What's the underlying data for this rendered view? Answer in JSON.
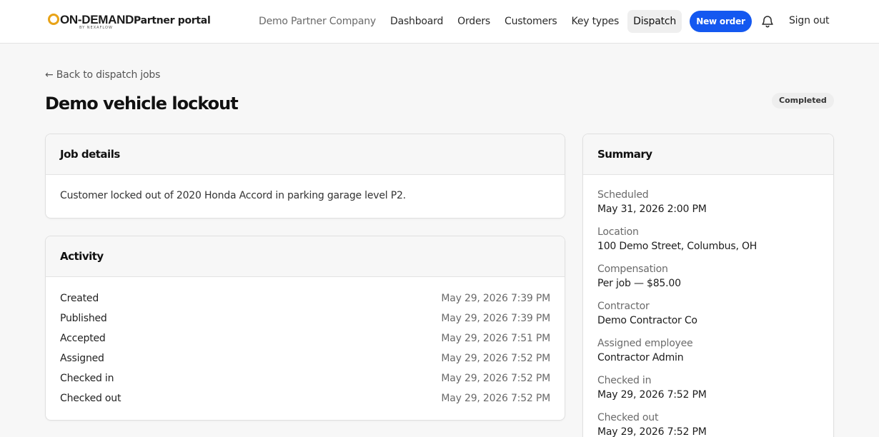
{
  "header": {
    "logo_text": "ON-DEMAND",
    "logo_subtext": "BY NEXAFLOW",
    "portal_label": "Partner portal",
    "company": "Demo Partner Company",
    "nav": [
      "Dashboard",
      "Orders",
      "Customers",
      "Key types",
      "Dispatch"
    ],
    "active_nav": "Dispatch",
    "new_order_label": "New order",
    "sign_out_label": "Sign out",
    "notification_icon": "bell-icon"
  },
  "page": {
    "back_link": "← Back to dispatch jobs",
    "title": "Demo vehicle lockout",
    "status": "Completed"
  },
  "job_details": {
    "heading": "Job details",
    "description": "Customer locked out of 2020 Honda Accord in parking garage level P2."
  },
  "activity": {
    "heading": "Activity",
    "events": [
      {
        "event": "Created",
        "time": "May 29, 2026 7:39 PM"
      },
      {
        "event": "Published",
        "time": "May 29, 2026 7:39 PM"
      },
      {
        "event": "Accepted",
        "time": "May 29, 2026 7:51 PM"
      },
      {
        "event": "Assigned",
        "time": "May 29, 2026 7:52 PM"
      },
      {
        "event": "Checked in",
        "time": "May 29, 2026 7:52 PM"
      },
      {
        "event": "Checked out",
        "time": "May 29, 2026 7:52 PM"
      }
    ]
  },
  "summary": {
    "heading": "Summary",
    "items": [
      {
        "label": "Scheduled",
        "value": "May 31, 2026 2:00 PM"
      },
      {
        "label": "Location",
        "value": "100 Demo Street, Columbus, OH"
      },
      {
        "label": "Compensation",
        "value": "Per job — $85.00"
      },
      {
        "label": "Contractor",
        "value": "Demo Contractor Co"
      },
      {
        "label": "Assigned employee",
        "value": "Contractor Admin"
      },
      {
        "label": "Checked in",
        "value": "May 29, 2026 7:52 PM"
      },
      {
        "label": "Checked out",
        "value": "May 29, 2026 7:52 PM"
      }
    ]
  },
  "colors": {
    "accent": "#1458f0",
    "logo_ring": "#e8a317",
    "background": "#f7f7f7"
  }
}
